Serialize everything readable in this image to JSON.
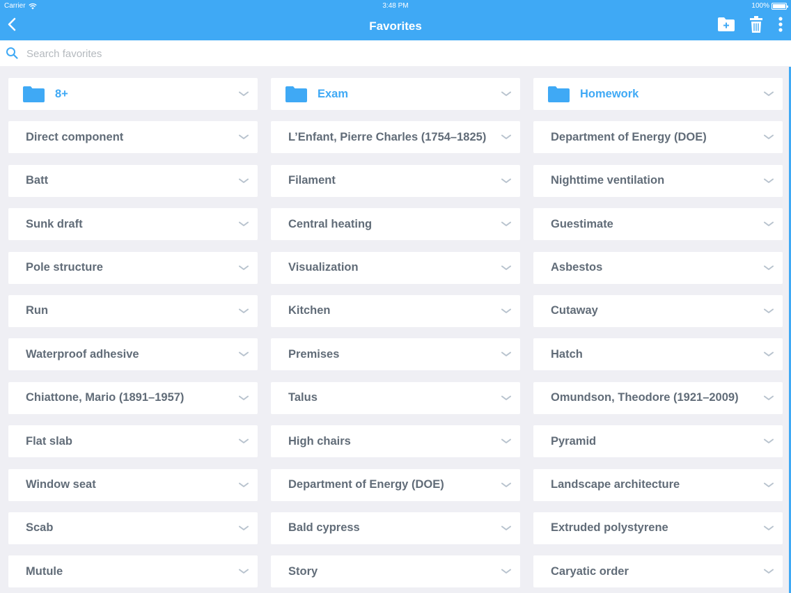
{
  "status_bar": {
    "carrier": "Carrier",
    "time": "3:48 PM",
    "battery": "100%"
  },
  "nav": {
    "title": "Favorites"
  },
  "search": {
    "placeholder": "Search favorites"
  },
  "colors": {
    "accent": "#3fa9f5",
    "text": "#616c78",
    "background": "#efeff4"
  },
  "icons": [
    "back-chevron-icon",
    "new-folder-icon",
    "trash-icon",
    "more-icon",
    "search-icon",
    "folder-icon",
    "chevron-down-icon"
  ],
  "folders": [
    {
      "label": "8+"
    },
    {
      "label": "Exam"
    },
    {
      "label": "Homework"
    }
  ],
  "items": [
    {
      "label": "Direct component"
    },
    {
      "label": "L’Enfant, Pierre Charles (1754–1825)"
    },
    {
      "label": "Department of Energy (DOE)"
    },
    {
      "label": "Batt"
    },
    {
      "label": "Filament"
    },
    {
      "label": "Nighttime ventilation"
    },
    {
      "label": "Sunk draft"
    },
    {
      "label": "Central heating"
    },
    {
      "label": "Guestimate"
    },
    {
      "label": "Pole structure"
    },
    {
      "label": "Visualization"
    },
    {
      "label": "Asbestos"
    },
    {
      "label": "Run"
    },
    {
      "label": "Kitchen"
    },
    {
      "label": "Cutaway"
    },
    {
      "label": "Waterproof adhesive"
    },
    {
      "label": "Premises"
    },
    {
      "label": "Hatch"
    },
    {
      "label": "Chiattone, Mario (1891–1957)"
    },
    {
      "label": "Talus"
    },
    {
      "label": "Omundson, Theodore (1921–2009)"
    },
    {
      "label": "Flat slab"
    },
    {
      "label": "High chairs"
    },
    {
      "label": "Pyramid"
    },
    {
      "label": "Window seat"
    },
    {
      "label": "Department of Energy (DOE)"
    },
    {
      "label": "Landscape architecture"
    },
    {
      "label": "Scab"
    },
    {
      "label": "Bald cypress"
    },
    {
      "label": "Extruded polystyrene"
    },
    {
      "label": "Mutule"
    },
    {
      "label": "Story"
    },
    {
      "label": "Caryatic order"
    }
  ]
}
